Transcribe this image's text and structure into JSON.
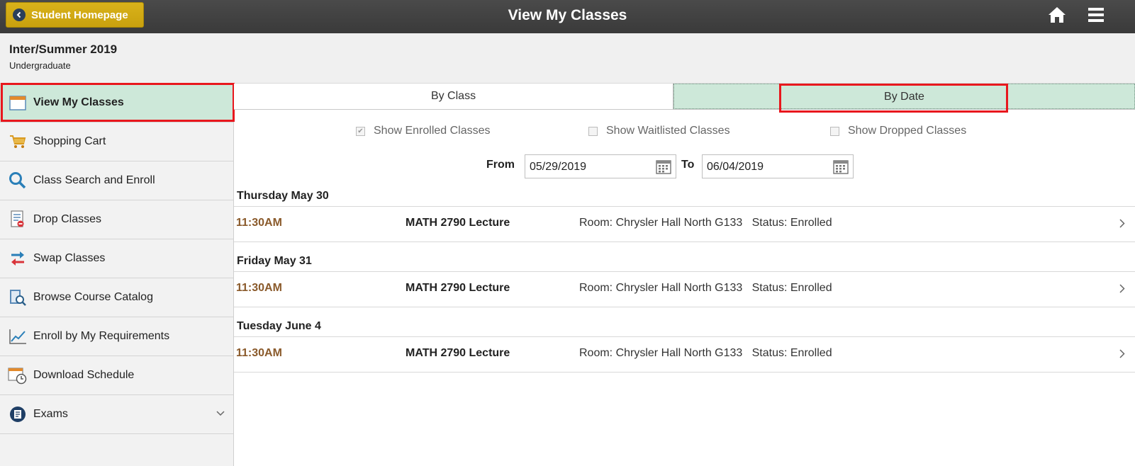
{
  "header": {
    "back_label": "Student Homepage",
    "title": "View My Classes",
    "icons": [
      "home-icon",
      "menu-icon"
    ]
  },
  "term": {
    "title": "Inter/Summer 2019",
    "career": "Undergraduate"
  },
  "sidebar": {
    "items": [
      {
        "label": "View My Classes",
        "icon": "calendar-icon",
        "active": true
      },
      {
        "label": "Shopping Cart",
        "icon": "cart-icon"
      },
      {
        "label": "Class Search and Enroll",
        "icon": "search-icon"
      },
      {
        "label": "Drop Classes",
        "icon": "drop-document-icon"
      },
      {
        "label": "Swap Classes",
        "icon": "swap-arrows-icon"
      },
      {
        "label": "Browse Course Catalog",
        "icon": "catalog-search-icon"
      },
      {
        "label": "Enroll by My Requirements",
        "icon": "line-chart-icon"
      },
      {
        "label": "Download Schedule",
        "icon": "calendar-clock-icon"
      },
      {
        "label": "Exams",
        "icon": "exams-icon"
      }
    ]
  },
  "tabs": {
    "by_class": "By Class",
    "by_date": "By Date",
    "selected": "By Date"
  },
  "filters": {
    "enrolled": {
      "label": "Show Enrolled Classes",
      "checked": true
    },
    "waitlisted": {
      "label": "Show Waitlisted Classes",
      "checked": false
    },
    "dropped": {
      "label": "Show Dropped Classes",
      "checked": false
    }
  },
  "range": {
    "from_label": "From",
    "from_value": "05/29/2019",
    "to_label": "To",
    "to_value": "06/04/2019"
  },
  "schedule": [
    {
      "day": "Thursday May 30",
      "time": "11:30AM",
      "course": "MATH 2790 Lecture",
      "info": "Room: Chrysler Hall North G133   Status: Enrolled"
    },
    {
      "day": "Friday May 31",
      "time": "11:30AM",
      "course": "MATH 2790 Lecture",
      "info": "Room: Chrysler Hall North G133   Status: Enrolled"
    },
    {
      "day": "Tuesday June 4",
      "time": "11:30AM",
      "course": "MATH 2790 Lecture",
      "info": "Room: Chrysler Hall North G133   Status: Enrolled"
    }
  ],
  "colors": {
    "header_bg": "#3f3f3f",
    "back_button": "#d4ab14",
    "active_bg": "#cde8d9",
    "highlight": "#e8171d",
    "time_text": "#8a5a2b"
  }
}
